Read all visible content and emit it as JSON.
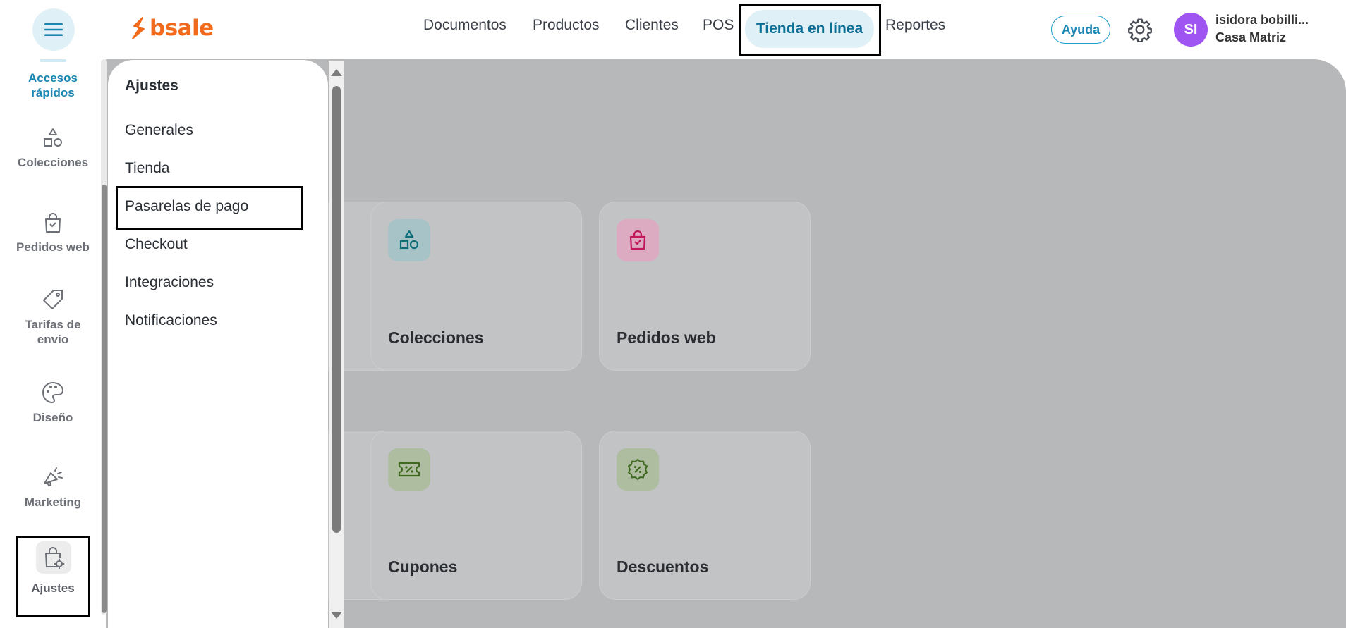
{
  "brand": {
    "name": "bsale",
    "color": "#f26b1d"
  },
  "nav": {
    "items": [
      "Documentos",
      "Productos",
      "Clientes",
      "POS"
    ],
    "active": "Tienda en línea",
    "last": "Reportes",
    "accent": "#0b6e94"
  },
  "header": {
    "help_label": "Ayuda",
    "settings_icon": "gear-icon",
    "user_initials": "SI",
    "user_name": "isidora bobilli...",
    "user_branch": "Casa Matriz",
    "avatar_color": "#9f55f2"
  },
  "rail": {
    "items": [
      {
        "label": "Accesos rápidos",
        "icon": "quick-access-icon"
      },
      {
        "label": "Colecciones",
        "icon": "shapes-icon"
      },
      {
        "label": "Pedidos web",
        "icon": "shopping-bag-icon"
      },
      {
        "label": "Tarifas de envío",
        "icon": "tag-icon"
      },
      {
        "label": "Diseño",
        "icon": "palette-icon"
      },
      {
        "label": "Marketing",
        "icon": "megaphone-icon"
      },
      {
        "label": "Ajustes",
        "icon": "bag-gear-icon"
      }
    ]
  },
  "submenu": {
    "title": "Ajustes",
    "items": [
      "Generales",
      "Tienda",
      "Pasarelas de pago",
      "Checkout",
      "Integraciones",
      "Notificaciones"
    ]
  },
  "cards": [
    {
      "title": "Colecciones",
      "icon": "shapes-icon",
      "color": "#0f6d7a"
    },
    {
      "title": "Pedidos web",
      "icon": "shopping-bag-icon",
      "color": "#c2185b"
    },
    {
      "title": "Cupones",
      "icon": "coupon-icon",
      "color": "#3f6a1f"
    },
    {
      "title": "Descuentos",
      "icon": "discount-badge-icon",
      "color": "#3f6a1f"
    }
  ]
}
